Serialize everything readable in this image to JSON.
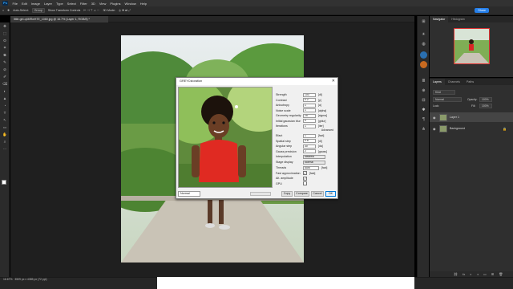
{
  "app": {
    "logo": "Ps",
    "menu": [
      "File",
      "Edit",
      "Image",
      "Layer",
      "Type",
      "Select",
      "Filter",
      "3D",
      "View",
      "Plugins",
      "Window",
      "Help"
    ]
  },
  "options_bar": {
    "auto_select_label": "Auto-Select:",
    "auto_select_value": "Group",
    "transform_label": "Show Transform Controls",
    "mode_label": "3D Mode:",
    "share_label": "Share"
  },
  "document": {
    "tab_label": "little-girl-q4MRwH7E_1080.jpg @ 16.7% (Layer 1, RGB/8) *",
    "zoom": "16.67%",
    "status": "3509 px x 4385 px (72 ppi)"
  },
  "tools": [
    "✥",
    "⬚",
    "ʘ",
    "⌗",
    "⧉",
    "✎",
    "⊘",
    "✐",
    "⌫",
    "◐",
    "▲",
    "◔",
    "T",
    "↖",
    "▭",
    "✋",
    "⌕",
    "⋯"
  ],
  "right_icons": [
    "⊞",
    "☀",
    "◍",
    "≣",
    "⊕",
    "⊟",
    "✱",
    "¶",
    "⋔"
  ],
  "navigator": {
    "tabs": [
      "Navigator",
      "Histogram"
    ]
  },
  "layers": {
    "tabs": [
      "Layers",
      "Channels",
      "Paths"
    ],
    "kind_label": "Kind",
    "blend_mode": "Normal",
    "opacity_label": "Opacity:",
    "opacity_value": "100%",
    "lock_label": "Lock:",
    "fill_label": "Fill:",
    "fill_value": "100%",
    "items": [
      {
        "name": "Layer 1",
        "selected": true
      },
      {
        "name": "Background",
        "selected": false
      }
    ],
    "bottom_icons": [
      "⛓",
      "fx",
      "◐",
      "◑",
      "▭",
      "⊞",
      "🗑"
    ]
  },
  "dialog": {
    "title": "GREYCstoration",
    "close_glyph": "✕",
    "params": [
      {
        "label": "Strength",
        "value": "100",
        "unit": "[dt]"
      },
      {
        "label": "Contrast",
        "value": "0.2",
        "unit": "[p]"
      },
      {
        "label": "Anisotropy",
        "value": "1",
        "unit": "[a]"
      },
      {
        "label": "Noise scale",
        "value": "1",
        "unit": "[alpha]"
      },
      {
        "label": "Geometry regularity",
        "value": "25",
        "unit": "[sigma]"
      },
      {
        "label": "Initial gaussian blur",
        "value": "0",
        "unit": "[gblur]"
      },
      {
        "label": "Iterations",
        "value": "1",
        "unit": "[iter]"
      }
    ],
    "advanced_label": "Advanced",
    "advanced_params": [
      {
        "label": "Efact",
        "value": "1",
        "unit": "[fact]"
      },
      {
        "label": "Spatial step",
        "value": "0.8",
        "unit": "[dl]"
      },
      {
        "label": "Angular step",
        "value": "30",
        "unit": "[da]"
      },
      {
        "label": "Gauss precision",
        "value": "2",
        "unit": "[gauss]"
      }
    ],
    "interpolation_label": "Interpolation",
    "interpolation_value": "Nearest",
    "stage_label": "Stage display",
    "stage_value": "Normal",
    "threads_label": "Threads",
    "threads_value": "Auto",
    "threads_unit": "[fact]",
    "checks": [
      {
        "label": "Fast approximation",
        "checked": true,
        "unit": "[fast]"
      },
      {
        "label": "Alt. amplitude",
        "checked": true,
        "unit": ""
      },
      {
        "label": "GPU",
        "checked": false,
        "unit": ""
      }
    ],
    "mode_value": "Normal",
    "buttons": {
      "copy": "Copy",
      "compare": "Compare",
      "cancel": "Cancel",
      "ok": "OK"
    }
  }
}
